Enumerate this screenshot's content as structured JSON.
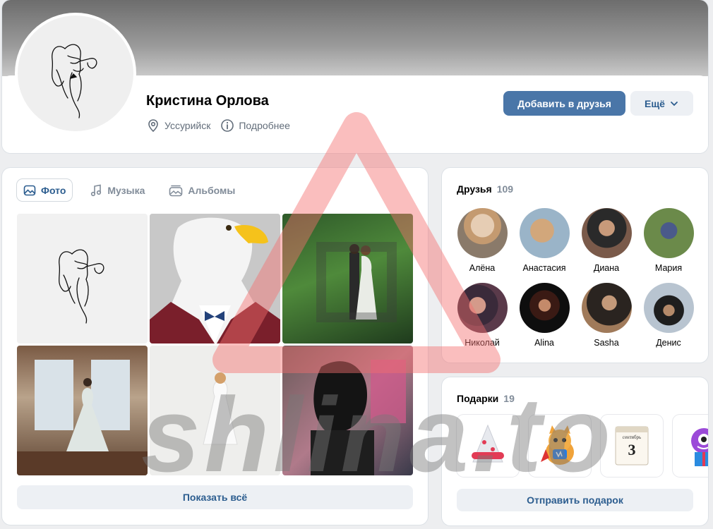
{
  "profile": {
    "name": "Кристина Орлова",
    "city": "Уссурийск",
    "more_label": "Подробнее",
    "add_friend_label": "Добавить в друзья",
    "more_menu_label": "Ещё"
  },
  "photos": {
    "tabs": [
      {
        "label": "Фото",
        "icon": "image-icon",
        "active": true
      },
      {
        "label": "Музыка",
        "icon": "music-note-icon",
        "active": false
      },
      {
        "label": "Альбомы",
        "icon": "albums-icon",
        "active": false
      }
    ],
    "items": [
      {
        "desc": "line-drawing-portrait"
      },
      {
        "desc": "eagle-in-suit"
      },
      {
        "desc": "couple-in-greenery"
      },
      {
        "desc": "bride-in-window"
      },
      {
        "desc": "woman-in-white"
      },
      {
        "desc": "woman-dark-hair"
      }
    ],
    "show_all_label": "Показать всё"
  },
  "friends": {
    "title": "Друзья",
    "count": "109",
    "list": [
      {
        "name": "Алёна",
        "color": "#c9b39a"
      },
      {
        "name": "Анастасия",
        "color": "#b8a58e"
      },
      {
        "name": "Диана",
        "color": "#3b2c24"
      },
      {
        "name": "Мария",
        "color": "#6b7a4a"
      },
      {
        "name": "Николай",
        "color": "#5a3a3a"
      },
      {
        "name": "Alina",
        "color": "#141414"
      },
      {
        "name": "Sasha",
        "color": "#8a6a58"
      },
      {
        "name": "Денис",
        "color": "#a7b2bd"
      }
    ]
  },
  "gifts": {
    "title": "Подарки",
    "count": "19",
    "send_label": "Отправить подарок",
    "items": [
      {
        "icon": "gift-tree-icon"
      },
      {
        "icon": "gift-cat-icon"
      },
      {
        "icon": "gift-calendar-icon"
      },
      {
        "icon": "gift-monster-icon"
      }
    ],
    "calendar_month": "сентябрь",
    "calendar_day": "3"
  },
  "watermark": "shlina.to",
  "colors": {
    "accent": "#4a76a8",
    "link": "#2c5d8f",
    "secondary_bg": "#edf0f4",
    "page_bg": "#edeef0"
  }
}
